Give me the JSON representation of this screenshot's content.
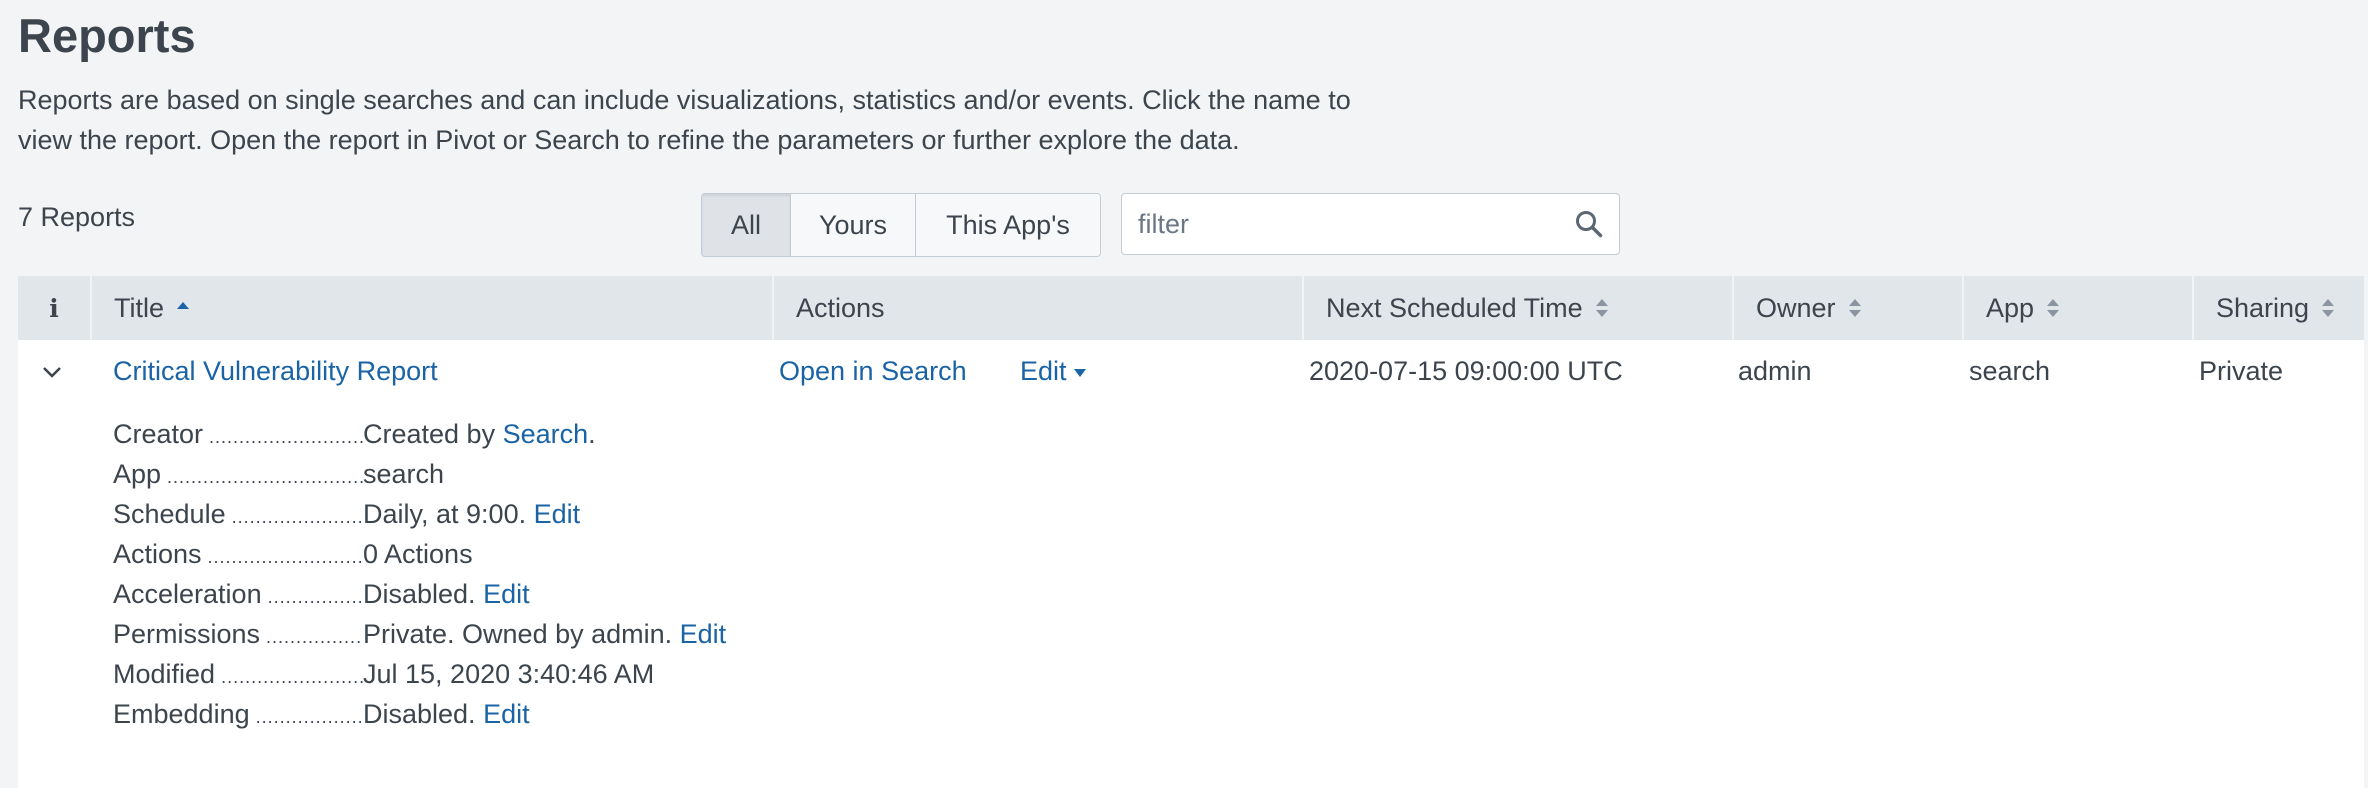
{
  "header": {
    "title": "Reports",
    "description_line1": "Reports are based on single searches and can include visualizations, statistics and/or events. Click the name to",
    "description_line2": "view the report. Open the report in Pivot or Search to refine the parameters or further explore the data."
  },
  "toolbar": {
    "count": "7 Reports",
    "filter_buttons": {
      "all": "All",
      "yours": "Yours",
      "this_app": "This App's"
    },
    "active_filter": "All",
    "search": {
      "placeholder": "filter",
      "value": ""
    }
  },
  "table": {
    "columns": {
      "info": "i",
      "title": "Title",
      "actions": "Actions",
      "next_scheduled": "Next Scheduled Time",
      "owner": "Owner",
      "app": "App",
      "sharing": "Sharing"
    },
    "sorted_by": "Title",
    "rows": [
      {
        "title": "Critical Vulnerability Report",
        "open_in_search": "Open in Search",
        "edit": "Edit",
        "next_scheduled": "2020-07-15 09:00:00 UTC",
        "owner": "admin",
        "app": "search",
        "sharing": "Private",
        "expanded": true,
        "details": {
          "creator": {
            "label": "Creator",
            "prefix": "Created by ",
            "link": "Search",
            "suffix": "."
          },
          "app": {
            "label": "App",
            "value": "search"
          },
          "schedule": {
            "label": "Schedule",
            "value": "Daily, at 9:00. ",
            "link": "Edit"
          },
          "actions": {
            "label": "Actions",
            "value": "0 Actions"
          },
          "acceleration": {
            "label": "Acceleration",
            "value": "Disabled. ",
            "link": "Edit"
          },
          "permissions": {
            "label": "Permissions",
            "value": "Private. Owned by admin. ",
            "link": "Edit"
          },
          "modified": {
            "label": "Modified",
            "value": "Jul 15, 2020 3:40:46 AM"
          },
          "embedding": {
            "label": "Embedding",
            "value": "Disabled. ",
            "link": "Edit"
          }
        }
      }
    ]
  },
  "colors": {
    "link": "#1a63a5",
    "header_bg": "#e1e6eb",
    "page_bg": "#f2f4f5"
  }
}
